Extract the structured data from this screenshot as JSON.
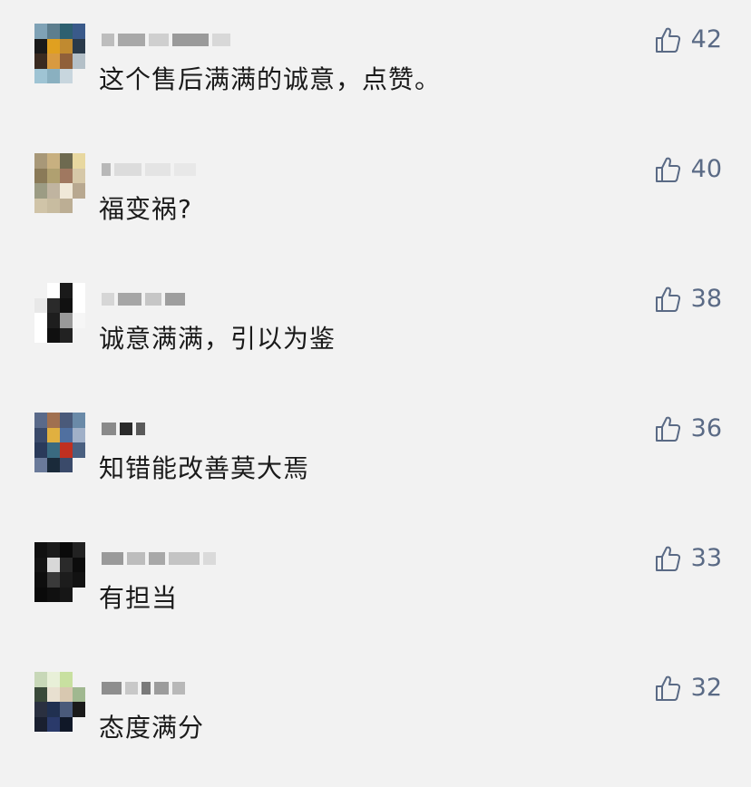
{
  "accent_color": "#5a6a85",
  "comments": [
    {
      "text": "这个售后满满的诚意，点赞。",
      "likes": "42",
      "avatar": "photo-avatar",
      "name_redacted": true
    },
    {
      "text": "福变祸?",
      "likes": "40",
      "avatar": "photo-avatar",
      "name_redacted": true
    },
    {
      "text": "诚意满满，引以为鉴",
      "likes": "38",
      "avatar": "photo-avatar",
      "name_redacted": true
    },
    {
      "text": "知错能改善莫大焉",
      "likes": "36",
      "avatar": "photo-avatar",
      "name_redacted": true
    },
    {
      "text": "有担当",
      "likes": "33",
      "avatar": "photo-avatar",
      "name_redacted": true
    },
    {
      "text": "态度满分",
      "likes": "32",
      "avatar": "photo-avatar",
      "name_redacted": true
    }
  ],
  "like_icon": "thumbs-up-icon"
}
